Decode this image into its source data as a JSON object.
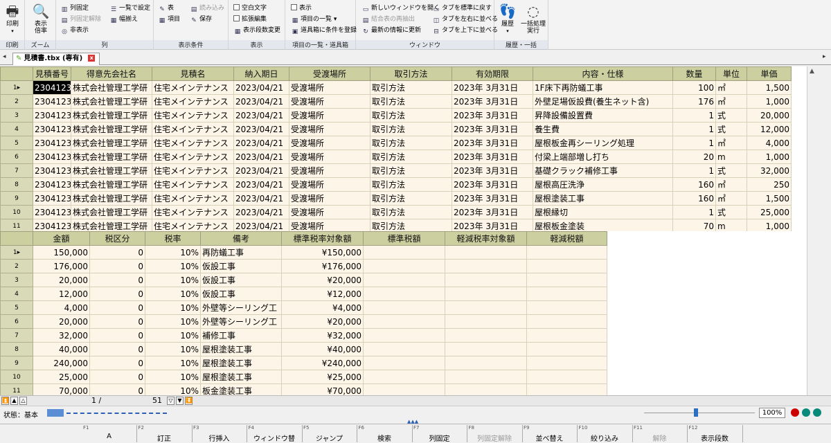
{
  "ribbon": {
    "print": {
      "label": "印刷",
      "group": "印刷"
    },
    "zoom": {
      "label1": "表示",
      "label2": "倍率",
      "group": "ズーム"
    },
    "col": {
      "fix": "列固定",
      "unfix": "列固定解除",
      "hide": "非表示",
      "list_setting": "一覧で設定",
      "width": "幅揃え",
      "group": "列"
    },
    "cond": {
      "table": "表",
      "item": "項目",
      "read": "読み込み",
      "save": "保存",
      "group": "表示条件"
    },
    "disp": {
      "blank": "空白文字",
      "expand": "拡張編集",
      "rows": "表示段数変更",
      "group": "表示"
    },
    "items": {
      "show": "表示",
      "list": "項目の一覧",
      "tools": "道具箱に条件を登録",
      "group": "項目の一覧・道具箱"
    },
    "window": {
      "new": "新しいウィンドウを開く",
      "recompute": "結合表の再抽出",
      "refresh": "最新の情報に更新",
      "std": "タブを標準に戻す",
      "lr": "タブを左右に並べる",
      "tb": "タブを上下に並べる",
      "group": "ウィンドウ"
    },
    "history": {
      "hist": "履歴",
      "batch1": "一括処理",
      "batch2": "実行",
      "group": "履歴・一括"
    }
  },
  "tab": {
    "title": "見積書.tbx (専有)",
    "close": "x"
  },
  "grid1": {
    "headers": [
      "見積番号",
      "得意先会社名",
      "見積名",
      "納入期日",
      "受渡場所",
      "取引方法",
      "有効期限",
      "内容・仕様",
      "数量",
      "単位",
      "単価"
    ],
    "rows": [
      [
        "2304123",
        "株式会社管理工学研",
        "住宅メインテナンス",
        "2023/04/21",
        "受渡場所",
        "取引方法",
        "2023年 3月31日",
        "1F床下再防蟻工事",
        "100",
        "㎡",
        "1,500"
      ],
      [
        "2304123",
        "株式会社管理工学研",
        "住宅メインテナンス",
        "2023/04/21",
        "受渡場所",
        "取引方法",
        "2023年 3月31日",
        "外壁足場仮設費(養生ネット含)",
        "176",
        "㎡",
        "1,000"
      ],
      [
        "2304123",
        "株式会社管理工学研",
        "住宅メインテナンス",
        "2023/04/21",
        "受渡場所",
        "取引方法",
        "2023年 3月31日",
        "昇降設備設置費",
        "1",
        "式",
        "20,000"
      ],
      [
        "2304123",
        "株式会社管理工学研",
        "住宅メインテナンス",
        "2023/04/21",
        "受渡場所",
        "取引方法",
        "2023年 3月31日",
        "養生費",
        "1",
        "式",
        "12,000"
      ],
      [
        "2304123",
        "株式会社管理工学研",
        "住宅メインテナンス",
        "2023/04/21",
        "受渡場所",
        "取引方法",
        "2023年 3月31日",
        "屋根板金再シーリング処理",
        "1",
        "㎡",
        "4,000"
      ],
      [
        "2304123",
        "株式会社管理工学研",
        "住宅メインテナンス",
        "2023/04/21",
        "受渡場所",
        "取引方法",
        "2023年 3月31日",
        "付梁上端部増し打ち",
        "20",
        "m",
        "1,000"
      ],
      [
        "2304123",
        "株式会社管理工学研",
        "住宅メインテナンス",
        "2023/04/21",
        "受渡場所",
        "取引方法",
        "2023年 3月31日",
        "基礎クラック補修工事",
        "1",
        "式",
        "32,000"
      ],
      [
        "2304123",
        "株式会社管理工学研",
        "住宅メインテナンス",
        "2023/04/21",
        "受渡場所",
        "取引方法",
        "2023年 3月31日",
        "屋根高圧洗浄",
        "160",
        "㎡",
        "250"
      ],
      [
        "2304123",
        "株式会社管理工学研",
        "住宅メインテナンス",
        "2023/04/21",
        "受渡場所",
        "取引方法",
        "2023年 3月31日",
        "屋根塗装工事",
        "160",
        "㎡",
        "1,500"
      ],
      [
        "2304123",
        "株式会社管理工学研",
        "住宅メインテナンス",
        "2023/04/21",
        "受渡場所",
        "取引方法",
        "2023年 3月31日",
        "屋根縁切",
        "1",
        "式",
        "25,000"
      ],
      [
        "2304123",
        "株式会社管理工学研",
        "住宅メインテナンス",
        "2023/04/21",
        "受渡場所",
        "取引方法",
        "2023年 3月31日",
        "屋根板金塗装",
        "70",
        "m",
        "1,000"
      ]
    ]
  },
  "grid2": {
    "headers": [
      "金額",
      "税区分",
      "税率",
      "備考",
      "標準税率対象額",
      "標準税額",
      "軽減税率対象額",
      "軽減税額"
    ],
    "rows": [
      [
        "150,000",
        "0",
        "10%",
        "再防蟻工事",
        "¥150,000",
        "",
        "",
        ""
      ],
      [
        "176,000",
        "0",
        "10%",
        "仮設工事",
        "¥176,000",
        "",
        "",
        ""
      ],
      [
        "20,000",
        "0",
        "10%",
        "仮設工事",
        "¥20,000",
        "",
        "",
        ""
      ],
      [
        "12,000",
        "0",
        "10%",
        "仮設工事",
        "¥12,000",
        "",
        "",
        ""
      ],
      [
        "4,000",
        "0",
        "10%",
        "外壁等シーリング工",
        "¥4,000",
        "",
        "",
        ""
      ],
      [
        "20,000",
        "0",
        "10%",
        "外壁等シーリング工",
        "¥20,000",
        "",
        "",
        ""
      ],
      [
        "32,000",
        "0",
        "10%",
        "補修工事",
        "¥32,000",
        "",
        "",
        ""
      ],
      [
        "40,000",
        "0",
        "10%",
        "屋根塗装工事",
        "¥40,000",
        "",
        "",
        ""
      ],
      [
        "240,000",
        "0",
        "10%",
        "屋根塗装工事",
        "¥240,000",
        "",
        "",
        ""
      ],
      [
        "25,000",
        "0",
        "10%",
        "屋根塗装工事",
        "¥25,000",
        "",
        "",
        ""
      ],
      [
        "70,000",
        "0",
        "10%",
        "板金塗装工事",
        "¥70,000",
        "",
        "",
        ""
      ]
    ]
  },
  "pager": {
    "current": "1 /",
    "total": "51"
  },
  "status": {
    "label": "状態：基本",
    "zoom": "100%"
  },
  "fkeys": [
    {
      "n": "F1",
      "l": "A"
    },
    {
      "n": "F2",
      "l": "訂正"
    },
    {
      "n": "F3",
      "l": "行挿入"
    },
    {
      "n": "F4",
      "l": "ウィンドウ替"
    },
    {
      "n": "F5",
      "l": "ジャンプ"
    },
    {
      "n": "F6",
      "l": "検索"
    },
    {
      "n": "F7",
      "l": "列固定"
    },
    {
      "n": "F8",
      "l": "列固定解除"
    },
    {
      "n": "F9",
      "l": "並べ替え"
    },
    {
      "n": "F10",
      "l": "絞り込み"
    },
    {
      "n": "F11",
      "l": "解除"
    },
    {
      "n": "F12",
      "l": "表示段数"
    }
  ],
  "colors": {
    "header": "#ccd0a0",
    "cell": "#fdf5e8",
    "accent": "#5b8fd4"
  }
}
